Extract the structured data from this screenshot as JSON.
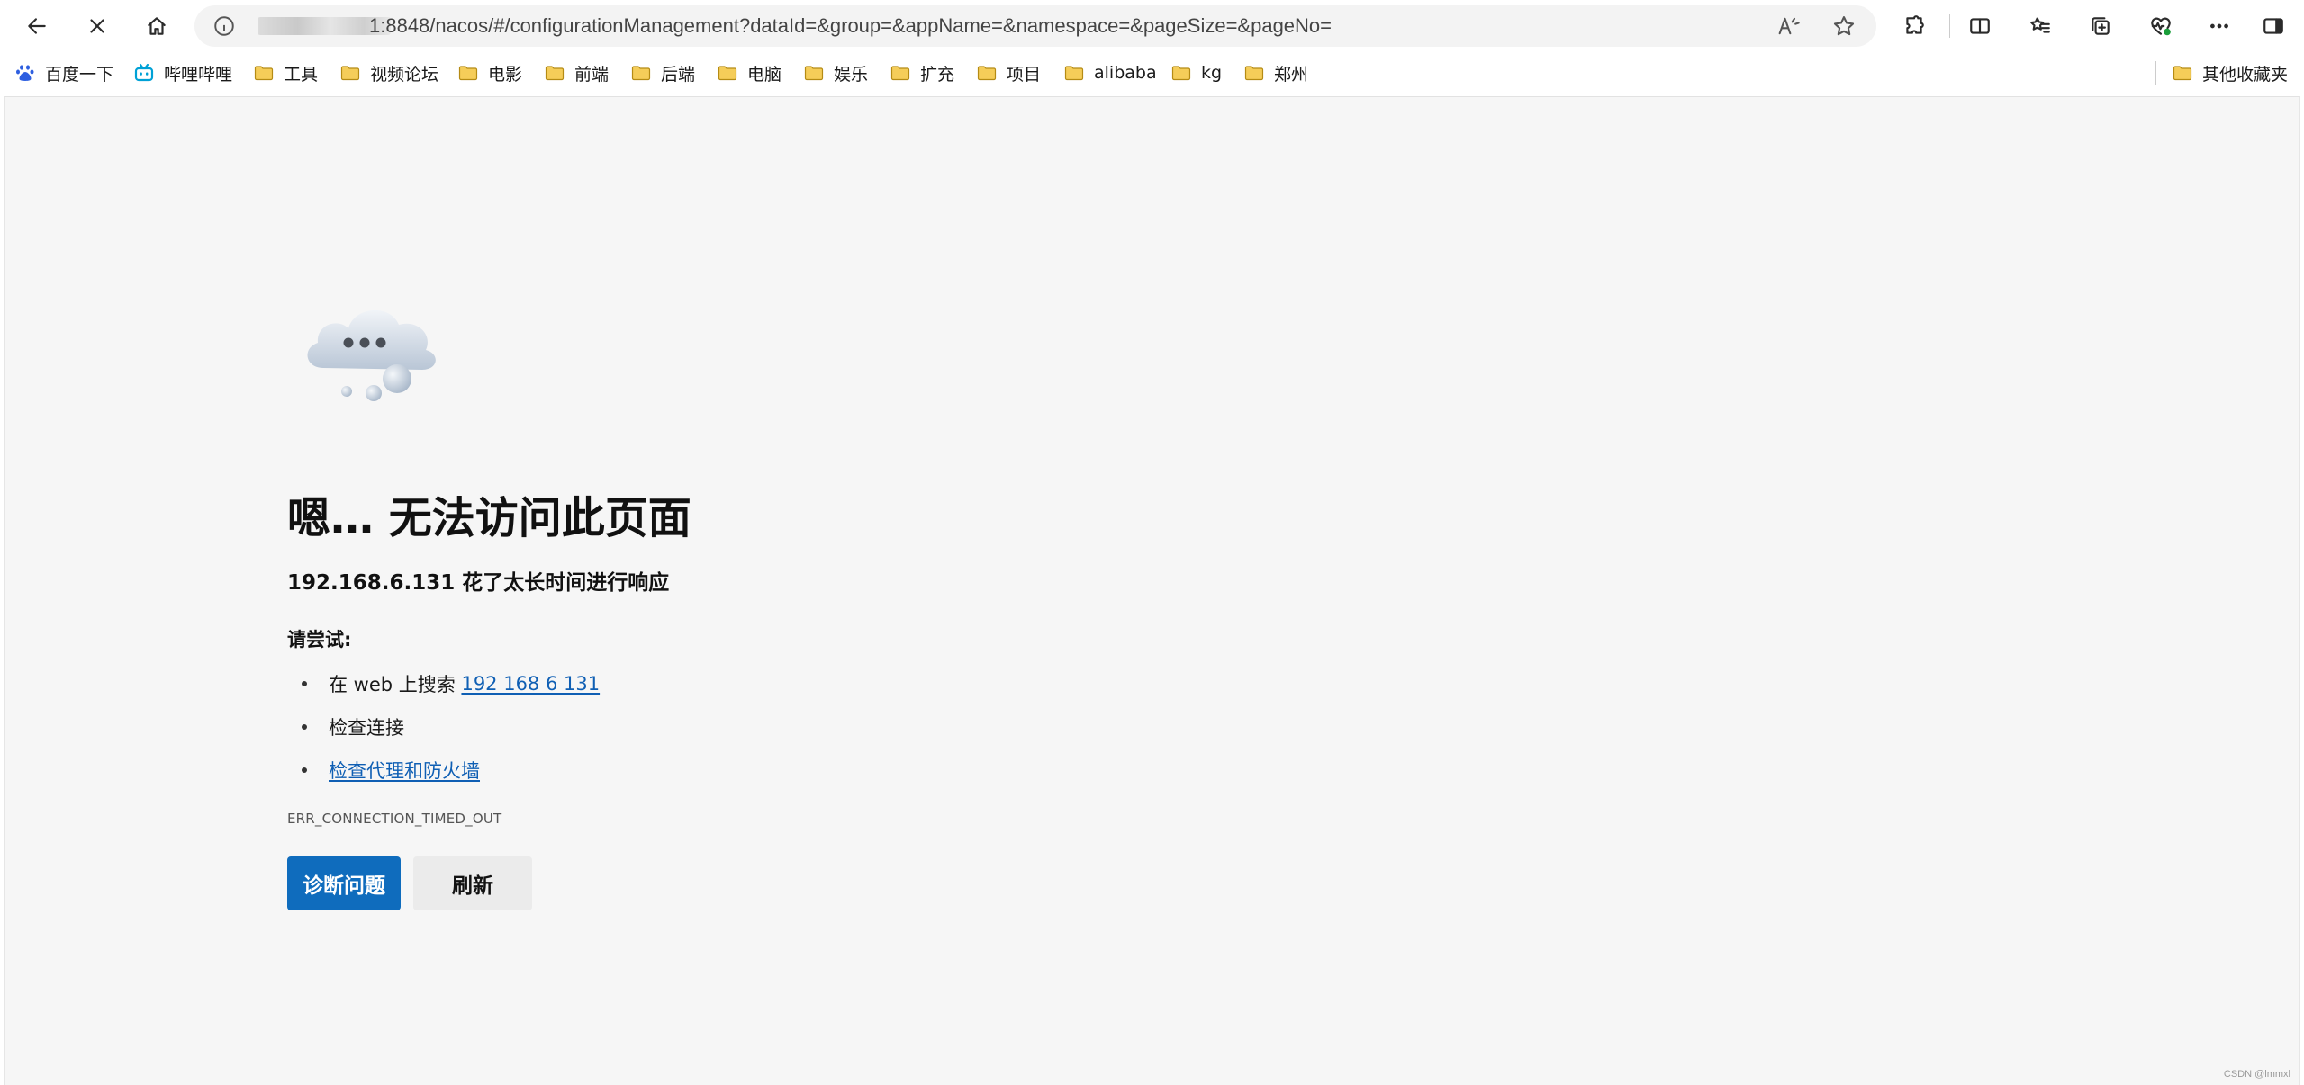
{
  "browser": {
    "url_text": "1:8848/nacos/#/configurationManagement?dataId=&group=&appName=&namespace=&pageSize=&pageNo="
  },
  "bookmarks": {
    "items": [
      {
        "label": "百度一下",
        "icon": "baidu-icon"
      },
      {
        "label": "哔哩哔哩",
        "icon": "bilibili-icon"
      },
      {
        "label": "工具",
        "icon": "folder-icon"
      },
      {
        "label": "视频论坛",
        "icon": "folder-icon"
      },
      {
        "label": "电影",
        "icon": "folder-icon"
      },
      {
        "label": "前端",
        "icon": "folder-icon"
      },
      {
        "label": "后端",
        "icon": "folder-icon"
      },
      {
        "label": "电脑",
        "icon": "folder-icon"
      },
      {
        "label": "娱乐",
        "icon": "folder-icon"
      },
      {
        "label": "扩充",
        "icon": "folder-icon"
      },
      {
        "label": "项目",
        "icon": "folder-icon"
      },
      {
        "label": "alibaba",
        "icon": "folder-icon"
      },
      {
        "label": "kg",
        "icon": "folder-icon"
      },
      {
        "label": "郑州",
        "icon": "folder-icon"
      }
    ],
    "other": "其他收藏夹"
  },
  "error": {
    "headline": "嗯… 无法访问此页面",
    "subtitle": "192.168.6.131 花了太长时间进行响应",
    "try_label": "请尝试:",
    "suggestion_search_prefix": "在 web 上搜索 ",
    "suggestion_search_link": "192 168 6 131",
    "suggestion_check": "检查连接",
    "suggestion_proxy": "检查代理和防火墙",
    "code": "ERR_CONNECTION_TIMED_OUT",
    "diagnose_button": "诊断问题",
    "refresh_button": "刷新"
  },
  "watermark": "CSDN @lmmxl",
  "colors": {
    "primary_button": "#0f6cbd",
    "link": "#0f5fb4",
    "folder": "#f2c64b"
  }
}
